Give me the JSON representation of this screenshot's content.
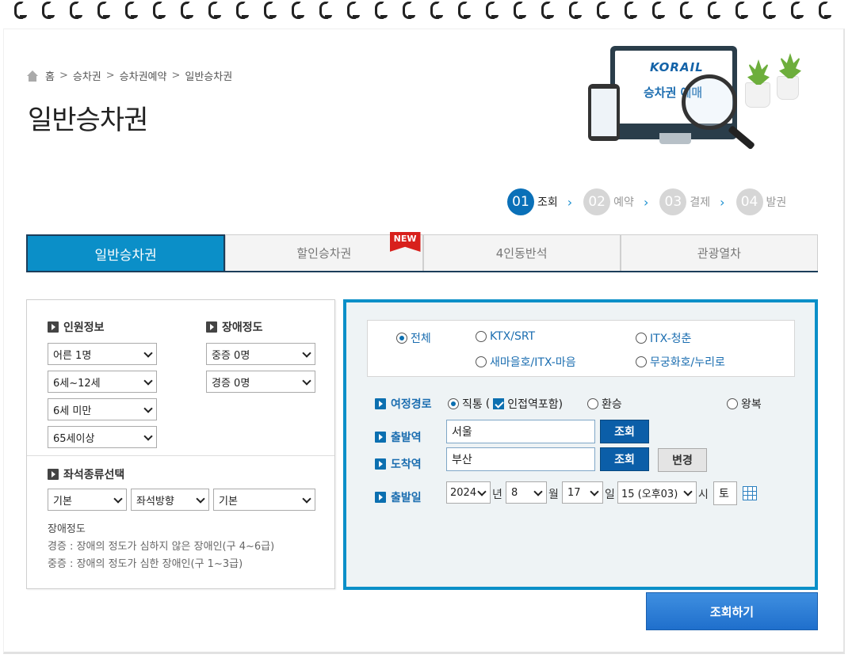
{
  "breadcrumb": {
    "items": [
      "홈",
      "승차권",
      "승차권예약",
      "일반승차권"
    ],
    "separator": ">"
  },
  "page_title": "일반승차권",
  "hero": {
    "logo": "KORAIL",
    "text": "승차권 예매"
  },
  "steps": [
    {
      "num": "01",
      "label": "조회",
      "active": true
    },
    {
      "num": "02",
      "label": "예약",
      "active": false
    },
    {
      "num": "03",
      "label": "결제",
      "active": false
    },
    {
      "num": "04",
      "label": "발권",
      "active": false
    }
  ],
  "step_chevron": ">",
  "tabs": [
    {
      "label": "일반승차권",
      "active": true
    },
    {
      "label": "할인승차권",
      "active": false,
      "badge": "NEW"
    },
    {
      "label": "4인동반석",
      "active": false
    },
    {
      "label": "관광열차",
      "active": false
    }
  ],
  "left": {
    "passengers_title": "인원정보",
    "disability_title": "장애정도",
    "passenger_selects": [
      "어른 1명",
      "6세~12세",
      "6세 미만",
      "65세이상"
    ],
    "disability_selects": [
      "중증 0명",
      "경증 0명"
    ],
    "seat_title": "좌석종류선택",
    "seat_selects": [
      "기본",
      "좌석방향",
      "기본"
    ],
    "info_title": "장애정도",
    "info_lines": [
      "경증 : 장애의 정도가 심하지 않은 장애인(구 4~6급)",
      "중증 : 장애의 정도가 심한 장애인(구 1~3급)"
    ]
  },
  "right": {
    "train_types": [
      {
        "label": "전체",
        "checked": true
      },
      {
        "label": "KTX/SRT",
        "checked": false
      },
      {
        "label": "ITX-청춘",
        "checked": false
      },
      {
        "label": "새마을호/ITX-마음",
        "checked": false
      },
      {
        "label": "무궁화호/누리로",
        "checked": false
      }
    ],
    "route_label": "여정경로",
    "route_direct": "직통",
    "route_direct_paren_open": "(",
    "route_nearby": "인접역포함)",
    "route_transfer": "환승",
    "route_roundtrip": "왕복",
    "departure_label": "출발역",
    "departure_value": "서울",
    "arrival_label": "도착역",
    "arrival_value": "부산",
    "lookup_button": "조회",
    "swap_button": "변경",
    "date_label": "출발일",
    "year": "2024",
    "year_unit": "년",
    "month": "8",
    "month_unit": "월",
    "day": "17",
    "day_unit": "일",
    "hour": "15 (오후03)",
    "hour_unit": "시",
    "weekday": "토"
  },
  "search_button": "조회하기",
  "colors": {
    "accent": "#0b8fc8",
    "dark_navy": "#1c3d5a",
    "link_blue": "#1a6db0",
    "badge_red": "#d8201c"
  }
}
